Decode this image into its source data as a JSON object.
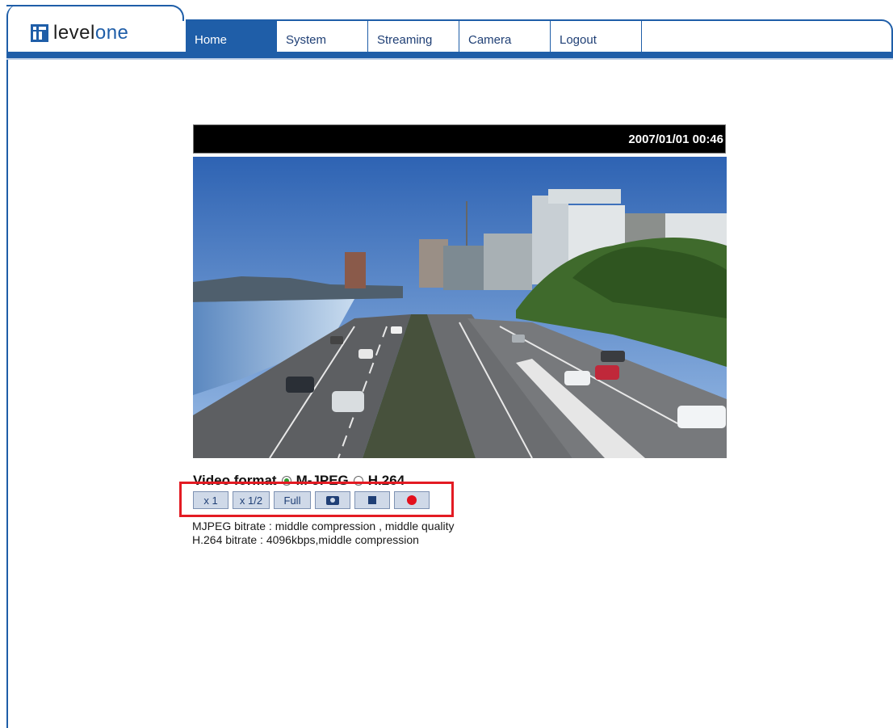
{
  "brand": {
    "name_a": "level",
    "name_b": "one"
  },
  "nav": {
    "tabs": [
      {
        "label": "Home",
        "active": true
      },
      {
        "label": "System",
        "active": false
      },
      {
        "label": "Streaming",
        "active": false
      },
      {
        "label": "Camera",
        "active": false
      },
      {
        "label": "Logout",
        "active": false
      }
    ]
  },
  "video": {
    "timestamp": "2007/01/01 00:46",
    "format_label": "Video format",
    "format_options": [
      {
        "label": "M-JPEG",
        "selected": true
      },
      {
        "label": "H.264",
        "selected": false
      }
    ]
  },
  "controls": {
    "zoom_x1": "x 1",
    "zoom_half": "x 1/2",
    "full": "Full",
    "snapshot_icon": "camera-icon",
    "stop_icon": "stop-icon",
    "record_icon": "record-icon"
  },
  "bitrate": {
    "mjpeg": "MJPEG bitrate : middle compression , middle quality",
    "h264": "H.264 bitrate : 4096kbps,middle compression"
  },
  "colors": {
    "brand_blue": "#1f5ea8",
    "highlight_red": "#e31b23",
    "record_red": "#e3101d",
    "selected_radio": "#2e9b32"
  }
}
